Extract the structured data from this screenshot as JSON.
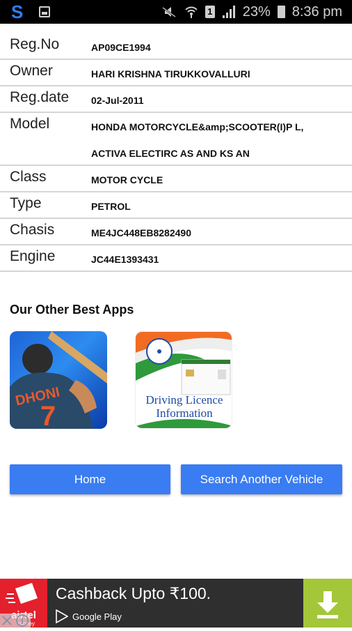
{
  "status_bar": {
    "battery": "23%",
    "time": "8:36 pm",
    "sim_slot": "1",
    "colors": {
      "background": "#000000",
      "text": "#d0d0d0"
    }
  },
  "vehicle_details": [
    {
      "label": "Reg.No",
      "value": "AP09CE1994"
    },
    {
      "label": "Owner",
      "value": "HARI KRISHNA TIRUKKOVALLURI"
    },
    {
      "label": "Reg.date",
      "value": "02-Jul-2011"
    },
    {
      "label": "Model",
      "value": "HONDA MOTORCYCLE&amp;SCOOTER(I)P L,",
      "value2": "ACTIVA ELECTIRC AS AND KS AN"
    },
    {
      "label": "Class",
      "value": "MOTOR CYCLE"
    },
    {
      "label": "Type",
      "value": "PETROL"
    },
    {
      "label": "Chasis",
      "value": "ME4JC448EB8282490"
    },
    {
      "label": "Engine",
      "value": "JC44E1393431"
    }
  ],
  "other_apps": {
    "title": "Our Other Best Apps",
    "apps": [
      {
        "name": "cricket-app",
        "jersey_name": "DHONI",
        "jersey_number": "7"
      },
      {
        "name": "driving-licence-app",
        "line1": "Driving Licence",
        "line2": "Information"
      }
    ]
  },
  "buttons": {
    "home": "Home",
    "search_another": "Search Another Vehicle",
    "color": "#3a7cf2"
  },
  "ad": {
    "brand": "airtel",
    "brand_sub": "money",
    "title": "Cashback Upto ₹100.",
    "store": "Google Play",
    "colors": {
      "logo_bg": "#e5202d",
      "bg": "#2f2f2f",
      "download_bg": "#a4c639"
    }
  }
}
